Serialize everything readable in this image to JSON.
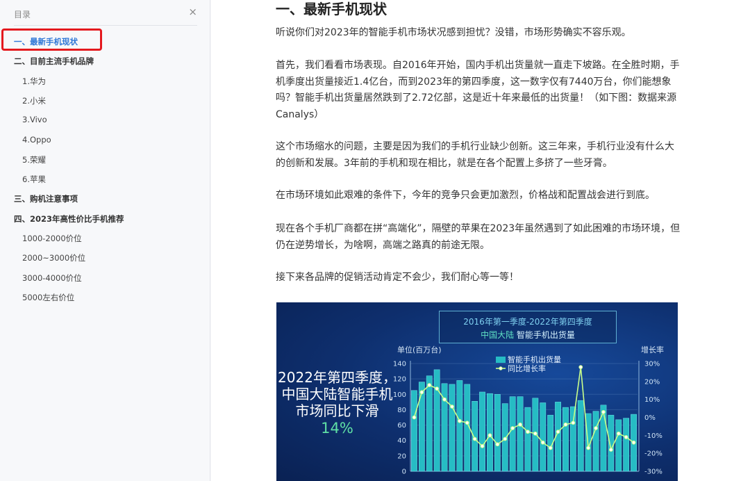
{
  "sidebar": {
    "title": "目录",
    "close_glyph": "×",
    "items": [
      {
        "label": "一、最新手机现状",
        "level": 1,
        "active": true
      },
      {
        "label": "二、目前主流手机品牌",
        "level": 1,
        "active": false
      },
      {
        "label": "1.华为",
        "level": 2,
        "active": false
      },
      {
        "label": "2.小米",
        "level": 2,
        "active": false
      },
      {
        "label": "3.Vivo",
        "level": 2,
        "active": false
      },
      {
        "label": "4.Oppo",
        "level": 2,
        "active": false
      },
      {
        "label": "5.荣耀",
        "level": 2,
        "active": false
      },
      {
        "label": "6.苹果",
        "level": 2,
        "active": false
      },
      {
        "label": "三、购机注意事项",
        "level": 1,
        "active": false
      },
      {
        "label": "四、2023年高性价比手机推荐",
        "level": 1,
        "active": false
      },
      {
        "label": "1000-2000价位",
        "level": 2,
        "active": false
      },
      {
        "label": "2000~3000价位",
        "level": 2,
        "active": false
      },
      {
        "label": "3000-4000价位",
        "level": 2,
        "active": false
      },
      {
        "label": "5000左右价位",
        "level": 2,
        "active": false
      }
    ]
  },
  "article": {
    "title": "一、最新手机现状",
    "paragraphs": [
      "听说你们对2023年的智能手机市场状况感到担忧？没错，市场形势确实不容乐观。",
      "首先，我们看看市场表现。自2016年开始，国内手机出货量就一直走下坡路。在全胜时期，手机季度出货量接近1.4亿台，而到2023年的第四季度，这一数字仅有7440万台，你们能想象吗？智能手机出货量居然跌到了2.72亿部，这是近十年来最低的出货量！（如下图：数据来源Canalys）",
      "这个市场缩水的问题，主要是因为我们的手机行业缺少创新。这三年来，手机行业没有什么大的创新和发展。3年前的手机和现在相比，就是在各个配置上多挤了一些牙膏。",
      "在市场环境如此艰难的条件下，今年的竞争只会更加激烈，价格战和配置战会进行到底。",
      "现在各个手机厂商都在拼“高端化”，隔壁的苹果在2023年虽然遇到了如此困难的市场环境，但仍在逆势增长，为啥啊，高端之路真的前途无限。",
      "接下来各品牌的促销活动肯定不会少，我们耐心等一等！"
    ]
  },
  "figure": {
    "title_line1": "2016年第一季度-2022年第四季度",
    "title_line2_highlight": "中国大陆",
    "title_line2_rest": "智能手机出货量",
    "unit_left": "单位(百万台)",
    "unit_right": "增长率",
    "headline": "2022年第四季度，中国大陆智能手机市场同比下滑",
    "headline_pct": "14%"
  },
  "chart_data": {
    "type": "bar",
    "series": [
      {
        "name": "智能手机出货量",
        "kind": "bar",
        "axis": "left",
        "values": [
          105,
          116,
          124,
          132,
          114,
          113,
          118,
          113,
          91,
          103,
          101,
          100,
          88,
          97,
          97,
          83,
          95,
          89,
          73,
          90,
          83,
          84,
          92,
          75,
          78,
          86,
          73,
          67,
          69,
          74
        ]
      },
      {
        "name": "同比增长率",
        "kind": "line",
        "axis": "right",
        "values": [
          0,
          14,
          18,
          16,
          10,
          6,
          -2,
          -3,
          -12,
          -16,
          -10,
          -15,
          -12,
          -6,
          -4,
          -8,
          -9,
          -14,
          -17,
          -8,
          -4,
          -3,
          28,
          -17,
          -6,
          3,
          -18,
          -9,
          -11,
          -14
        ]
      }
    ],
    "y_left": {
      "ticks": [
        0,
        20,
        40,
        60,
        80,
        100,
        120,
        140
      ],
      "range": [
        0,
        140
      ]
    },
    "y_right": {
      "ticks": [
        "30%",
        "20%",
        "10%",
        "0%",
        "-10%",
        "-20%",
        "-30%"
      ],
      "range": [
        -30,
        30
      ]
    },
    "colors": {
      "bar": "#26bcc4",
      "line": "#c9ff8a",
      "axis_text": "#cfe3f5"
    },
    "legend_position": "top-center"
  }
}
